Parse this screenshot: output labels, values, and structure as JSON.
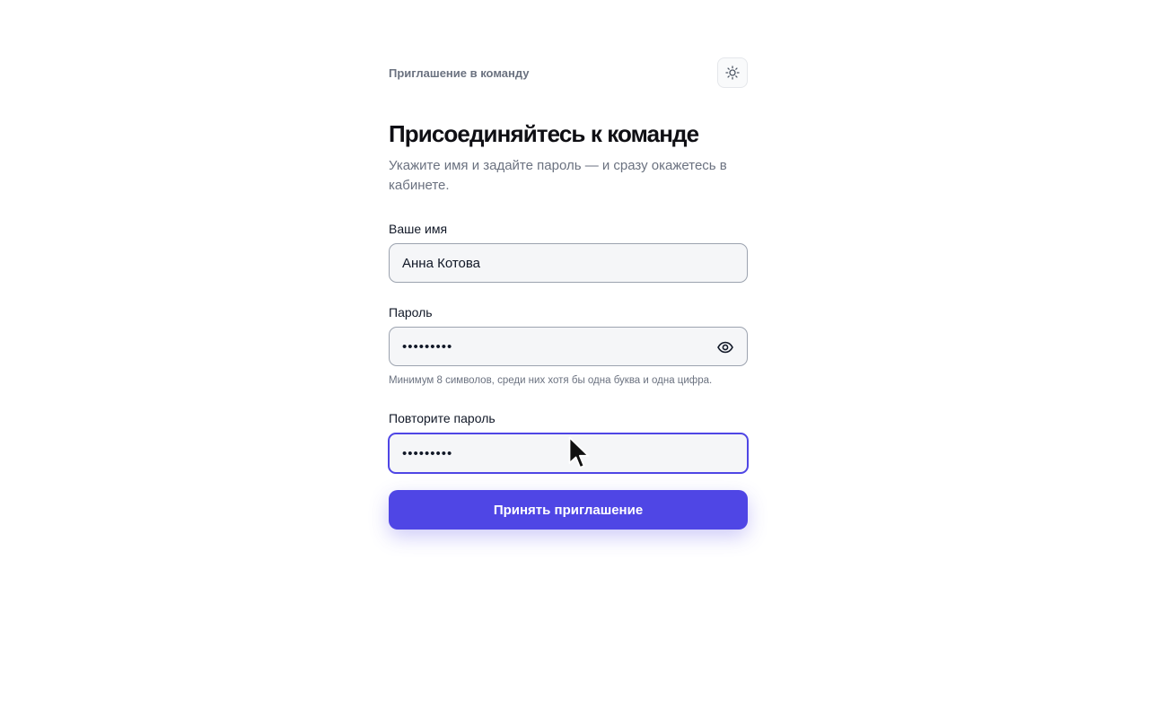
{
  "header": {
    "eyebrow": "Приглашение в команду",
    "theme_toggle_icon": "sun-icon"
  },
  "main": {
    "title": "Присоединяйтесь к команде",
    "subtitle": "Укажите имя и задайте пароль — и сразу окажетесь в кабинете."
  },
  "form": {
    "name": {
      "label": "Ваше имя",
      "value": "Анна Котова"
    },
    "password": {
      "label": "Пароль",
      "value": "•••••••••",
      "toggle_icon": "eye-icon",
      "hint": "Минимум 8 символов, среди них хотя бы одна буква и одна цифра."
    },
    "repeat_password": {
      "label": "Повторите пароль",
      "value": "•••••••••"
    },
    "submit_label": "Принять приглашение"
  },
  "colors": {
    "accent": "#4f46e5",
    "text": "#111827",
    "muted": "#6b7280",
    "input_bg": "#f5f6f8"
  }
}
